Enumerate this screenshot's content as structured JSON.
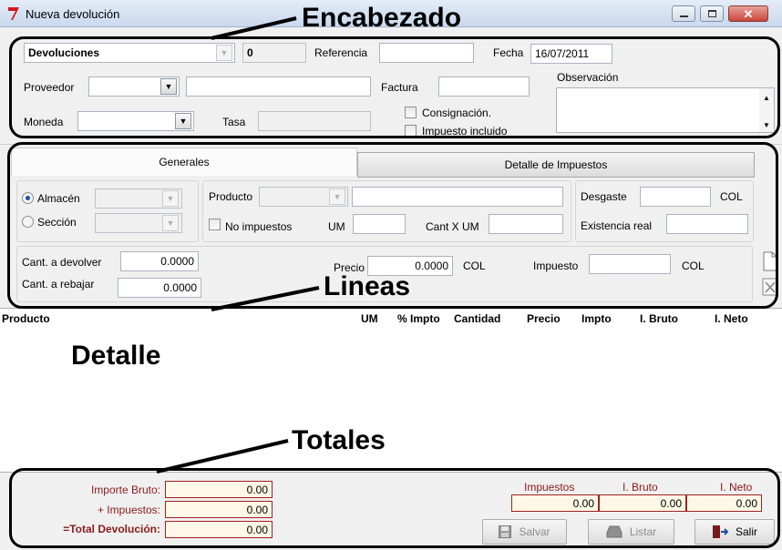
{
  "window": {
    "title": "Nueva devolución"
  },
  "annotations": {
    "header": "Encabezado",
    "lines": "Lineas",
    "detail": "Detalle",
    "totals": "Totales"
  },
  "header": {
    "type_value": "Devoluciones",
    "number_value": "0",
    "referencia_label": "Referencia",
    "referencia_value": "",
    "fecha_label": "Fecha",
    "fecha_value": "16/07/2011",
    "proveedor_label": "Proveedor",
    "factura_label": "Factura",
    "observacion_label": "Observación",
    "moneda_label": "Moneda",
    "tasa_label": "Tasa",
    "consignacion_label": "Consignación.",
    "impuesto_incluido_label": "Impuesto incluido"
  },
  "tabs": {
    "generales": "Generales",
    "detalle_impuestos": "Detalle de Impuestos"
  },
  "lines": {
    "almacen_label": "Almacén",
    "seccion_label": "Sección",
    "producto_label": "Producto",
    "no_impuestos_label": "No impuestos",
    "um_label": "UM",
    "cant_x_um_label": "Cant X UM",
    "desgaste_label": "Desgaste",
    "desgaste_currency": "COL",
    "existencia_label": "Existencia real",
    "cant_devolver_label": "Cant. a devolver",
    "cant_devolver_value": "0.0000",
    "cant_rebajar_label": "Cant. a rebajar",
    "cant_rebajar_value": "0.0000",
    "precio_label": "Precio",
    "precio_value": "0.0000",
    "precio_currency": "COL",
    "impuesto_label": "Impuesto",
    "impuesto_currency": "COL"
  },
  "grid": {
    "columns": [
      "Producto",
      "UM",
      "% Impto",
      "Cantidad",
      "Precio",
      "Impto",
      "I. Bruto",
      "I. Neto"
    ]
  },
  "totals": {
    "importe_bruto_label": "Importe Bruto:",
    "importe_bruto_value": "0.00",
    "impuestos_label": "+  Impuestos:",
    "impuestos_value": "0.00",
    "total_label": "=Total Devolución:",
    "total_value": "0.00",
    "col_impuestos": "Impuestos",
    "col_bruto": "I. Bruto",
    "col_neto": "I. Neto",
    "impuestos_sum": "0.00",
    "bruto_sum": "0.00",
    "neto_sum": "0.00"
  },
  "buttons": {
    "salvar": "Salvar",
    "listar": "Listar",
    "salir": "Salir"
  },
  "colors": {
    "title_gradient_top": "#dbe6f4",
    "close_red": "#c9463d",
    "totals_label": "#8b1a1a",
    "totals_border": "#a02020"
  }
}
